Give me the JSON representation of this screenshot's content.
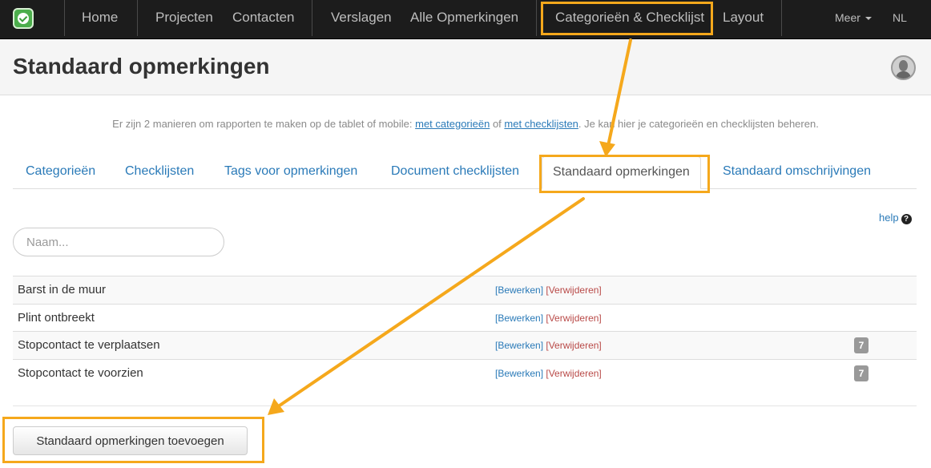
{
  "navbar": {
    "logo_icon": "app-logo-check-icon",
    "items": [
      {
        "label": "Home"
      },
      {
        "label": "Projecten"
      },
      {
        "label": "Contacten"
      },
      {
        "label": "Verslagen"
      },
      {
        "label": "Alle Opmerkingen"
      },
      {
        "label": "Categorieën & Checklijst"
      },
      {
        "label": "Layout"
      }
    ],
    "more_label": "Meer",
    "language": "NL"
  },
  "page": {
    "title": "Standaard opmerkingen",
    "avatar_icon": "user-avatar"
  },
  "intro": {
    "text_before": "Er zijn 2 manieren om rapporten te maken op de tablet of mobile: ",
    "link_categories": "met categorieën",
    "text_middle": " of ",
    "link_checklists": "met checklijsten",
    "text_after": ". Je kan hier je categorieën en checklijsten beheren."
  },
  "tabs": [
    {
      "label": "Categorieën"
    },
    {
      "label": "Checklijsten"
    },
    {
      "label": "Tags voor opmerkingen"
    },
    {
      "label": "Document checklijsten"
    },
    {
      "label": "Standaard opmerkingen",
      "active": true
    },
    {
      "label": "Standaard omschrijvingen"
    }
  ],
  "help": {
    "label": "help",
    "icon": "question-circle-icon",
    "icon_glyph": "?"
  },
  "search": {
    "placeholder": "Naam...",
    "value": ""
  },
  "remarks": {
    "edit_label": "[Bewerken]",
    "delete_label": "[Verwijderen]",
    "rows": [
      {
        "name": "Barst in de muur",
        "count": ""
      },
      {
        "name": "Plint ontbreekt",
        "count": ""
      },
      {
        "name": "Stopcontact te verplaatsen",
        "count": "7"
      },
      {
        "name": "Stopcontact te voorzien",
        "count": "7"
      }
    ]
  },
  "add_button": {
    "label": "Standaard opmerkingen toevoegen"
  },
  "colors": {
    "navbar_bg": "#1c1c1c",
    "link": "#2a7ab8",
    "danger": "#b94a48",
    "annotation": "#f5a81c",
    "badge": "#999999"
  }
}
